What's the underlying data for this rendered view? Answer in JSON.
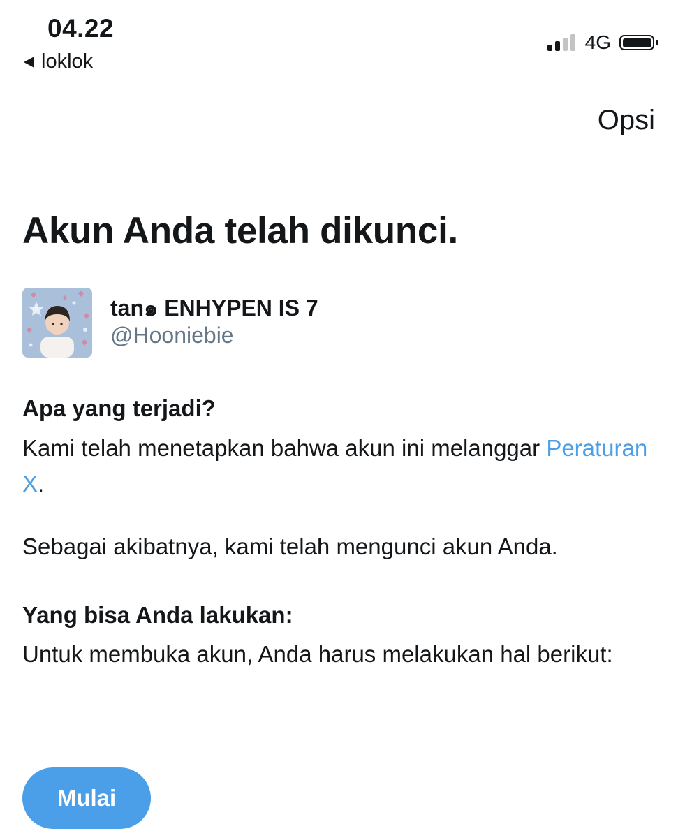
{
  "status_bar": {
    "time": "04.22",
    "back_label": "loklok",
    "network": "4G",
    "signal_bars_on": 2,
    "signal_bars_total": 4,
    "battery_level": 1.0
  },
  "header": {
    "options_label": "Opsi"
  },
  "main": {
    "title": "Akun Anda telah dikunci.",
    "profile": {
      "name": "tan๑ ENHYPEN IS 7",
      "handle": "@Hooniebie"
    },
    "what_happened": {
      "heading": "Apa yang terjadi?",
      "text_before_link": "Kami telah menetapkan bahwa akun ini melanggar ",
      "link_label": "Peraturan X",
      "text_after_link": ".",
      "consequence": "Sebagai akibatnya, kami telah mengunci akun Anda."
    },
    "what_you_can_do": {
      "heading": "Yang bisa Anda lakukan:",
      "text": "Untuk membuka akun, Anda harus melakukan hal berikut:"
    },
    "start_button_label": "Mulai"
  },
  "colors": {
    "accent": "#4a9fe8",
    "text": "#14171a",
    "secondary_text": "#657786"
  }
}
